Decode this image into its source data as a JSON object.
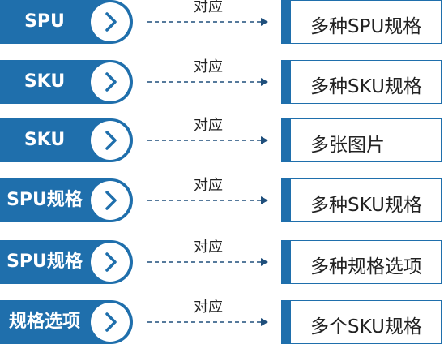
{
  "colors": {
    "accent": "#1f6fac",
    "text": "#222222",
    "background": "#ffffff"
  },
  "rows": [
    {
      "source": "SPU",
      "relation": "对应",
      "target": "多种SPU规格"
    },
    {
      "source": "SKU",
      "relation": "对应",
      "target": "多种SKU规格"
    },
    {
      "source": "SKU",
      "relation": "对应",
      "target": "多张图片"
    },
    {
      "source": "SPU规格",
      "relation": "对应",
      "target": "多种SKU规格"
    },
    {
      "source": "SPU规格",
      "relation": "对应",
      "target": "多种规格选项"
    },
    {
      "source": "规格选项",
      "relation": "对应",
      "target": "多个SKU规格"
    }
  ],
  "icons": {
    "pill_icon": "chevron-right-icon",
    "arrow": "dashed-arrow-right-icon"
  }
}
